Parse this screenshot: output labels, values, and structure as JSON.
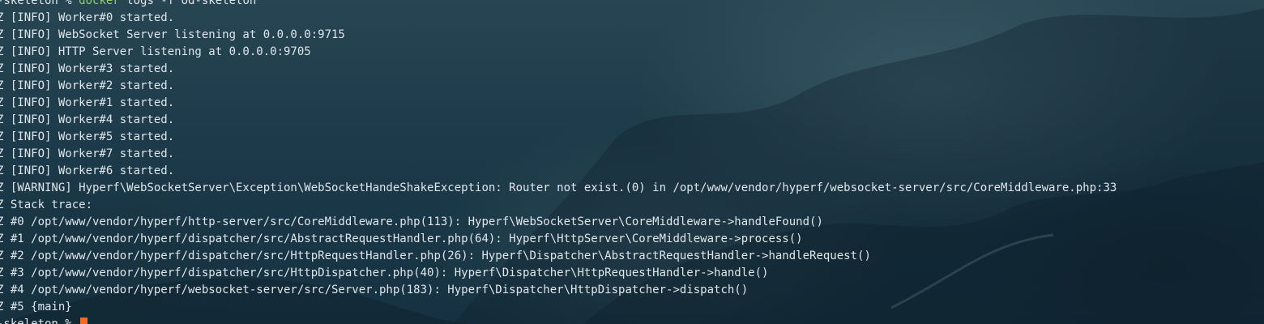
{
  "terminal": {
    "top_prompt": {
      "prefix": "-skeleton % ",
      "command_keyword": "docker",
      "command_rest": " logs -f od-skeleton"
    },
    "log_lines": [
      "Z [INFO] Worker#0 started.",
      "Z [INFO] WebSocket Server listening at 0.0.0.0:9715",
      "Z [INFO] HTTP Server listening at 0.0.0.0:9705",
      "Z [INFO] Worker#3 started.",
      "Z [INFO] Worker#2 started.",
      "Z [INFO] Worker#1 started.",
      "Z [INFO] Worker#4 started.",
      "Z [INFO] Worker#5 started.",
      "Z [INFO] Worker#7 started.",
      "Z [INFO] Worker#6 started.",
      "Z [WARNING] Hyperf\\WebSocketServer\\Exception\\WebSocketHandeShakeException: Router not exist.(0) in /opt/www/vendor/hyperf/websocket-server/src/CoreMiddleware.php:33",
      "Z Stack trace:",
      "Z #0 /opt/www/vendor/hyperf/http-server/src/CoreMiddleware.php(113): Hyperf\\WebSocketServer\\CoreMiddleware->handleFound()",
      "Z #1 /opt/www/vendor/hyperf/dispatcher/src/AbstractRequestHandler.php(64): Hyperf\\HttpServer\\CoreMiddleware->process()",
      "Z #2 /opt/www/vendor/hyperf/dispatcher/src/HttpRequestHandler.php(26): Hyperf\\Dispatcher\\AbstractRequestHandler->handleRequest()",
      "Z #3 /opt/www/vendor/hyperf/dispatcher/src/HttpDispatcher.php(40): Hyperf\\Dispatcher\\HttpRequestHandler->handle()",
      "Z #4 /opt/www/vendor/hyperf/websocket-server/src/Server.php(183): Hyperf\\Dispatcher\\HttpDispatcher->dispatch()",
      "Z #5 {main}"
    ],
    "bottom_prompt": {
      "prefix": "-skeleton % "
    },
    "colors": {
      "text": "#dfe6ea",
      "command_keyword": "#8fd06a",
      "cursor": "#f26d1f"
    }
  }
}
